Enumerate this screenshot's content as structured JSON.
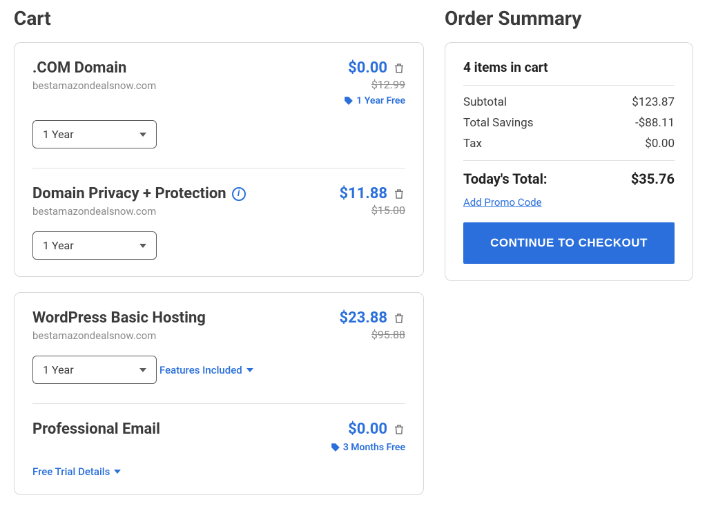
{
  "cart": {
    "title": "Cart",
    "groups": [
      {
        "items": [
          {
            "title": ".COM Domain",
            "sub": "bestamazondealsnow.com",
            "price": "$0.00",
            "strike": "$12.99",
            "badge": "1 Year Free",
            "term": "1 Year",
            "info": false,
            "divider_after": true
          },
          {
            "title": "Domain Privacy + Protection",
            "sub": "bestamazondealsnow.com",
            "price": "$11.88",
            "strike": "$15.00",
            "term": "1 Year",
            "info": true
          }
        ]
      },
      {
        "items": [
          {
            "title": "WordPress Basic Hosting",
            "sub": "bestamazondealsnow.com",
            "price": "$23.88",
            "strike": "$95.88",
            "term": "1 Year",
            "link": "Features Included",
            "divider_after": true
          },
          {
            "title": "Professional Email",
            "price": "$0.00",
            "badge": "3 Months Free",
            "link": "Free Trial Details"
          }
        ]
      }
    ]
  },
  "summary": {
    "title": "Order Summary",
    "count_label": "4 items in cart",
    "rows": [
      {
        "label": "Subtotal",
        "value": "$123.87"
      },
      {
        "label": "Total Savings",
        "value": "-$88.11"
      },
      {
        "label": "Tax",
        "value": "$0.00"
      }
    ],
    "total_label": "Today's Total:",
    "total_value": "$35.76",
    "promo": "Add Promo Code",
    "checkout": "CONTINUE TO CHECKOUT"
  }
}
